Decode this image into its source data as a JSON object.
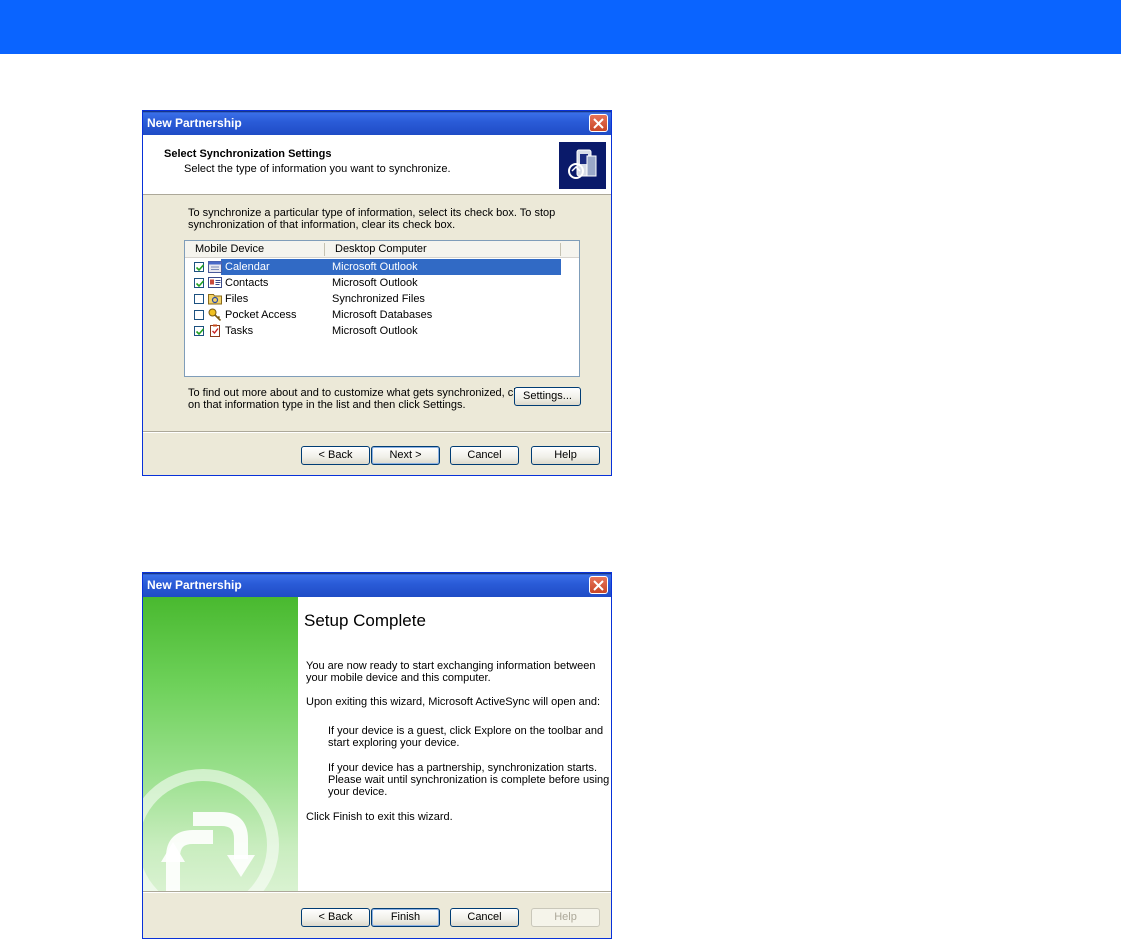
{
  "dialog1": {
    "title": "New Partnership",
    "header_title": "Select Synchronization Settings",
    "header_subtitle": "Select the type of information you want to synchronize.",
    "intro_line1": "To synchronize a particular type of information, select its check box. To stop",
    "intro_line2": "synchronization of that information, clear its check box.",
    "columns": {
      "device": "Mobile Device",
      "desktop": "Desktop Computer"
    },
    "rows": [
      {
        "name": "Calendar",
        "desktop": "Microsoft Outlook",
        "checked": true,
        "icon": "calendar-icon"
      },
      {
        "name": "Contacts",
        "desktop": "Microsoft Outlook",
        "checked": true,
        "icon": "contacts-icon"
      },
      {
        "name": "Files",
        "desktop": "Synchronized Files",
        "checked": false,
        "icon": "files-icon"
      },
      {
        "name": "Pocket Access",
        "desktop": "Microsoft Databases",
        "checked": false,
        "icon": "pocket-access-icon"
      },
      {
        "name": "Tasks",
        "desktop": "Microsoft Outlook",
        "checked": true,
        "icon": "tasks-icon"
      }
    ],
    "footer_line1": "To find out more about and to customize what gets synchronized, click",
    "footer_line2": "on that information type in the list and then click Settings.",
    "settings_label": "Settings...",
    "back_label": "< Back",
    "next_label": "Next >",
    "cancel_label": "Cancel",
    "help_label": "Help"
  },
  "dialog2": {
    "title": "New Partnership",
    "heading": "Setup Complete",
    "p1_line1": "You are now ready to start exchanging information between",
    "p1_line2": "your mobile device and this computer.",
    "p2": "Upon exiting this wizard, Microsoft ActiveSync will open and:",
    "p3_line1": "If your device is a guest, click Explore on the toolbar and",
    "p3_line2": "start exploring your device.",
    "p4_line1": "If your device has a partnership, synchronization starts.",
    "p4_line2": "Please wait until synchronization is complete before using",
    "p4_line3": "your device.",
    "p5": "Click Finish to exit this wizard.",
    "back_label": "< Back",
    "finish_label": "Finish",
    "cancel_label": "Cancel",
    "help_label": "Help"
  },
  "colors": {
    "titlebar": "#2a5bd7",
    "selection": "#316ac5",
    "dialog_bg": "#ece9d8",
    "top_band": "#0a64ff"
  }
}
